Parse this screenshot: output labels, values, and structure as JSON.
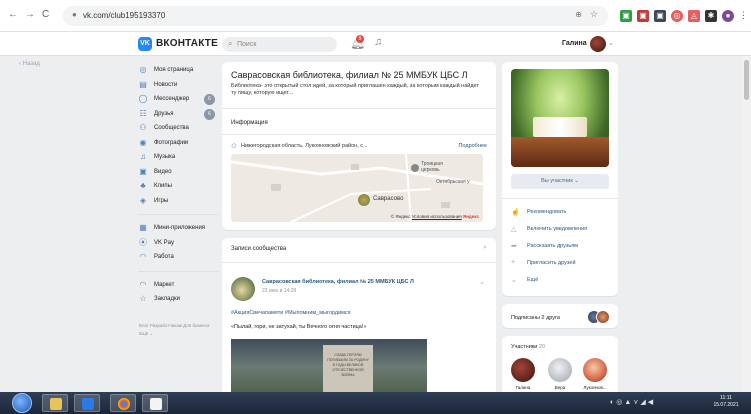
{
  "browser": {
    "url": "vk.com/club195193370",
    "nav": {
      "back": "←",
      "forward": "→",
      "reload": "C"
    }
  },
  "header": {
    "logo_text": "ВКОНТАКТЕ",
    "search_placeholder": "Поиск",
    "notification_count": "9",
    "user_name": "Галина"
  },
  "back_link": "Назад",
  "sidebar": {
    "items": [
      {
        "label": "Моя страница",
        "icon": "user-icon",
        "glyph": "◎"
      },
      {
        "label": "Новости",
        "icon": "news-icon",
        "glyph": "▤"
      },
      {
        "label": "Мессенджер",
        "icon": "chat-icon",
        "glyph": "◯",
        "count": "6"
      },
      {
        "label": "Друзья",
        "icon": "friends-icon",
        "glyph": "☷",
        "count": "6"
      },
      {
        "label": "Сообщества",
        "icon": "groups-icon",
        "glyph": "⚇"
      },
      {
        "label": "Фотографии",
        "icon": "photo-icon",
        "glyph": "◉"
      },
      {
        "label": "Музыка",
        "icon": "music-icon",
        "glyph": "♫"
      },
      {
        "label": "Видео",
        "icon": "video-icon",
        "glyph": "▣"
      },
      {
        "label": "Клипы",
        "icon": "clips-icon",
        "glyph": "♣"
      },
      {
        "label": "Игры",
        "icon": "games-icon",
        "glyph": "◈"
      }
    ],
    "items2": [
      {
        "label": "Мини-приложения",
        "icon": "apps-icon",
        "glyph": "▦"
      },
      {
        "label": "VK Pay",
        "icon": "pay-icon",
        "glyph": "⦿"
      },
      {
        "label": "Работа",
        "icon": "work-icon",
        "glyph": "◠"
      }
    ],
    "items3": [
      {
        "label": "Маркет",
        "icon": "market-icon",
        "glyph": "◠"
      },
      {
        "label": "Закладки",
        "icon": "bookmark-icon",
        "glyph": "☆"
      }
    ],
    "footer": "Блог Разработчикам Для бизнеса Ещё ⌄"
  },
  "group": {
    "title": "Саврасовская библиотека, филиал № 25 ММБУК ЦБС Л",
    "description": "Библиотека- это открытый стол идей, за который приглашен каждый, за которым каждый найдет ту пищу, которую ищет...",
    "info_label": "Информация",
    "location": "Нижегородская область, Лукояновский район, с...",
    "location_more": "Подробнее",
    "map": {
      "labels": [
        "Троицкая церковь",
        "Октябрьская у",
        "Саврасово"
      ],
      "footer_brand": "© Яндекс",
      "footer_link": "Условия использования",
      "footer_logo": "Яндекс"
    }
  },
  "wall": {
    "title": "Записи сообщества",
    "post": {
      "author": "Саврасовская библиотека, филиал № 25 ММБУК ЦБС Л",
      "date": "22 июн в 14:28",
      "tags": "#АкцияСвечапамяти #Мыпомним_мыгордимся",
      "text": "«Пылай, гори, не затухай, ты Вечного огня частица!»",
      "photo_caption": "СЛАВА ГЕРОЯМ ПОГИБШИМ ЗА РОДИНУ В ГОДЫ ВЕЛИКОЙ ОТЕЧЕСТВЕННОЙ ВОЙНЫ"
    }
  },
  "right": {
    "member_button": "Вы участник ⌄",
    "actions": [
      {
        "label": "Рекомендовать",
        "icon": "thumb-icon",
        "glyph": "☝"
      },
      {
        "label": "Включить уведомления",
        "icon": "bell-icon",
        "glyph": "△"
      },
      {
        "label": "Рассказать друзьям",
        "icon": "share-icon",
        "glyph": "➦"
      },
      {
        "label": "Пригласить друзей",
        "icon": "invite-icon",
        "glyph": "+"
      },
      {
        "label": "Ещё",
        "icon": "more-chevron-icon",
        "glyph": "⌄"
      }
    ],
    "subscriptions": "Подписаны 2 друга",
    "members_label": "Участники",
    "members_count": "20",
    "members": [
      {
        "name": "Галина"
      },
      {
        "name": "Вера"
      },
      {
        "name": "Лукоянов..."
      }
    ]
  },
  "taskbar": {
    "time": "11:11",
    "date": "15.07.2021"
  },
  "colors": {
    "accent": "#2787f5",
    "link": "#2a5885",
    "bg": "#edeef0"
  }
}
